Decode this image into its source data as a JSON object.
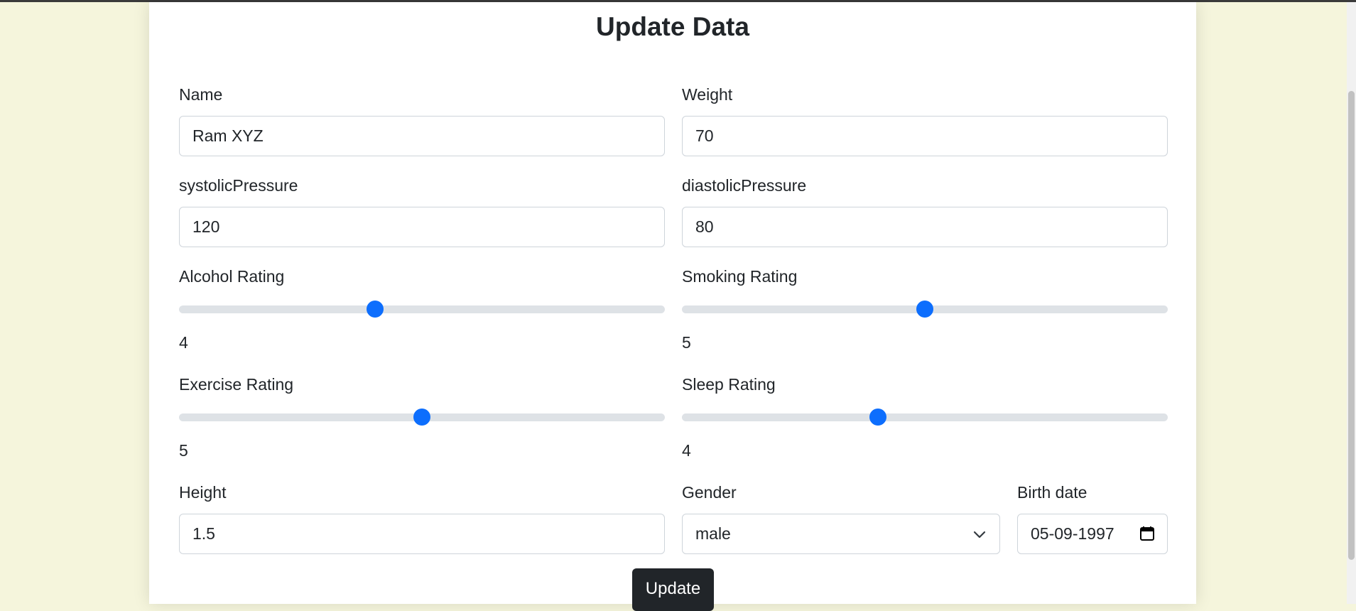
{
  "form": {
    "title": "Update Data",
    "name": {
      "label": "Name",
      "value": "Ram XYZ"
    },
    "weight": {
      "label": "Weight",
      "value": "70"
    },
    "systolic": {
      "label": "systolicPressure",
      "value": "120"
    },
    "diastolic": {
      "label": "diastolicPressure",
      "value": "80"
    },
    "alcohol": {
      "label": "Alcohol Rating",
      "value": "4"
    },
    "smoking": {
      "label": "Smoking Rating",
      "value": "5"
    },
    "exercise": {
      "label": "Exercise Rating",
      "value": "5"
    },
    "sleep": {
      "label": "Sleep Rating",
      "value": "4"
    },
    "height": {
      "label": "Height",
      "value": "1.5"
    },
    "gender": {
      "label": "Gender",
      "value": "male"
    },
    "birth": {
      "label": "Birth date",
      "value": "05-09-1997"
    },
    "submit_label": "Update"
  },
  "colors": {
    "background": "#f5f5dc",
    "accent": "#0d6efd",
    "button": "#212529"
  }
}
